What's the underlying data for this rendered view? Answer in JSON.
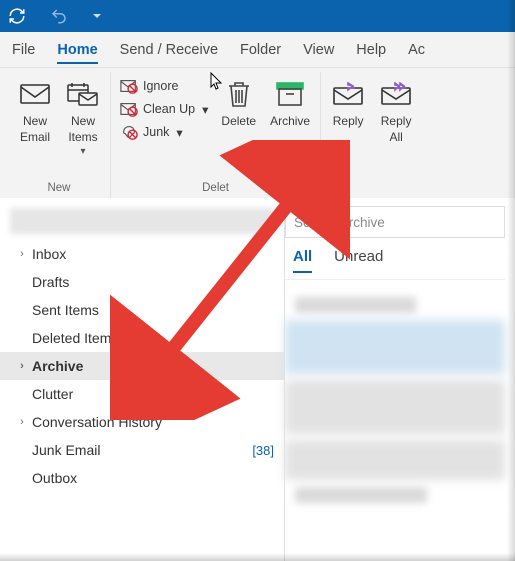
{
  "ribbon": {
    "tabs": [
      "File",
      "Home",
      "Send / Receive",
      "Folder",
      "View",
      "Help",
      "Ac"
    ],
    "active_tab": "Home",
    "groups": {
      "new": {
        "label": "New",
        "new_email": "New\nEmail",
        "new_items": "New\nItems"
      },
      "delete": {
        "label": "Delet",
        "ignore": "Ignore",
        "cleanup": "Clean Up",
        "junk": "Junk",
        "delete": "Delete",
        "archive": "Archive"
      },
      "respond": {
        "reply": "Reply",
        "reply_all": "Reply\nAll"
      }
    }
  },
  "folders": {
    "items": [
      {
        "name": "Inbox",
        "expandable": true
      },
      {
        "name": "Drafts"
      },
      {
        "name": "Sent Items"
      },
      {
        "name": "Deleted Items"
      },
      {
        "name": "Archive",
        "expandable": true,
        "selected": true
      },
      {
        "name": "Clutter"
      },
      {
        "name": "Conversation History",
        "expandable": true
      },
      {
        "name": "Junk Email",
        "count": "[38]"
      },
      {
        "name": "Outbox"
      }
    ]
  },
  "list": {
    "search_placeholder": "Search Archive",
    "tabs": {
      "all": "All",
      "unread": "Unread"
    }
  }
}
